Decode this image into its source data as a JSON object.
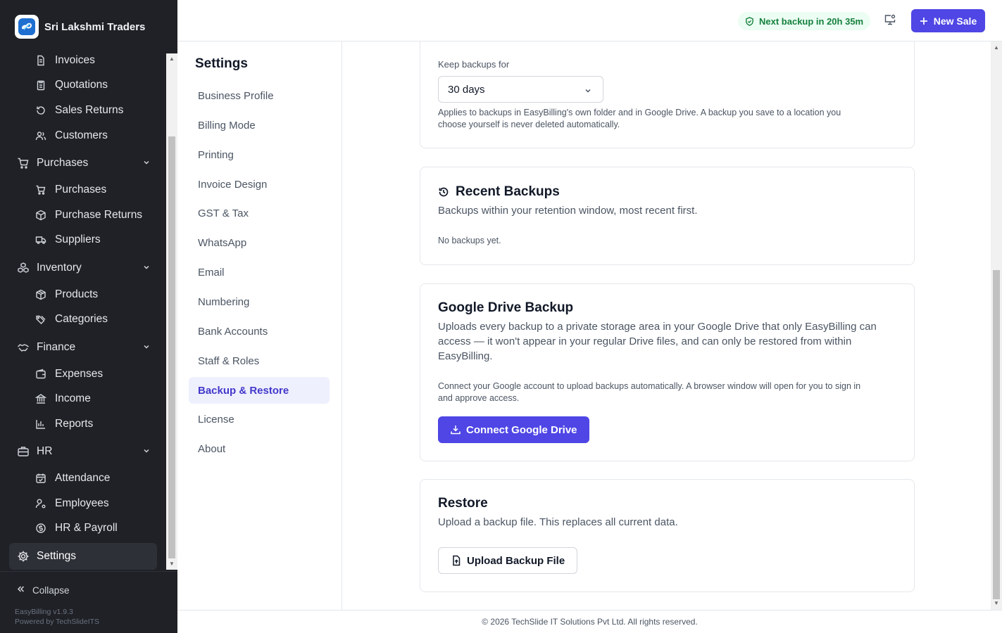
{
  "brand": {
    "name": "Sri Lakshmi Traders",
    "logo_icon": "infinity-logo-icon"
  },
  "sidebar": {
    "items": [
      {
        "label": "Invoices",
        "icon": "file-text-icon",
        "type": "child"
      },
      {
        "label": "Quotations",
        "icon": "clipboard-icon",
        "type": "child"
      },
      {
        "label": "Sales Returns",
        "icon": "rotate-ccw-icon",
        "type": "child"
      },
      {
        "label": "Customers",
        "icon": "users-icon",
        "type": "child"
      },
      {
        "label": "Purchases",
        "icon": "shopping-cart-icon",
        "type": "group"
      },
      {
        "label": "Purchases",
        "icon": "shopping-cart-icon",
        "type": "child"
      },
      {
        "label": "Purchase Returns",
        "icon": "package-return-icon",
        "type": "child"
      },
      {
        "label": "Suppliers",
        "icon": "truck-icon",
        "type": "child"
      },
      {
        "label": "Inventory",
        "icon": "boxes-icon",
        "type": "group"
      },
      {
        "label": "Products",
        "icon": "package-icon",
        "type": "child"
      },
      {
        "label": "Categories",
        "icon": "tags-icon",
        "type": "child"
      },
      {
        "label": "Finance",
        "icon": "handshake-icon",
        "type": "group"
      },
      {
        "label": "Expenses",
        "icon": "wallet-icon",
        "type": "child"
      },
      {
        "label": "Income",
        "icon": "landmark-icon",
        "type": "child"
      },
      {
        "label": "Reports",
        "icon": "bar-chart-icon",
        "type": "child"
      },
      {
        "label": "HR",
        "icon": "briefcase-icon",
        "type": "group"
      },
      {
        "label": "Attendance",
        "icon": "calendar-check-icon",
        "type": "child"
      },
      {
        "label": "Employees",
        "icon": "user-cog-icon",
        "type": "child"
      },
      {
        "label": "HR & Payroll",
        "icon": "badge-dollar-icon",
        "type": "child"
      },
      {
        "label": "Settings",
        "icon": "gear-icon",
        "type": "active"
      }
    ],
    "collapse_label": "Collapse",
    "version_line1": "EasyBilling v1.9.3",
    "version_line2": "Powered by TechSlideITS"
  },
  "topbar": {
    "backup_status": "Next backup in 20h 35m",
    "new_sale_label": "New Sale"
  },
  "settings_nav": {
    "title": "Settings",
    "items": [
      "Business Profile",
      "Billing Mode",
      "Printing",
      "Invoice Design",
      "GST & Tax",
      "WhatsApp",
      "Email",
      "Numbering",
      "Bank Accounts",
      "Staff & Roles",
      "Backup & Restore",
      "License",
      "About"
    ],
    "active": "Backup & Restore"
  },
  "retention": {
    "label": "Keep backups for",
    "selected": "30 days",
    "help_line1": "Applies to backups in EasyBilling's own folder and in Google Drive. A backup you save to a location you",
    "help_line2": "choose yourself is never deleted automatically."
  },
  "recent_backups": {
    "title": "Recent Backups",
    "description": "Backups within your retention window, most recent first.",
    "empty": "No backups yet."
  },
  "google_drive": {
    "title": "Google Drive Backup",
    "desc_line1": "Uploads every backup to a private storage area in your Google Drive that only EasyBilling can",
    "desc_line2": "access — it won't appear in your regular Drive files, and can only be restored from within",
    "desc_line3": "EasyBilling.",
    "note_line1": "Connect your Google account to upload backups automatically. A browser window will open for you to sign in",
    "note_line2": "and approve access.",
    "connect_label": "Connect Google Drive"
  },
  "restore": {
    "title": "Restore",
    "description": "Upload a backup file. This replaces all current data.",
    "upload_label": "Upload Backup File"
  },
  "footer": {
    "text": "© 2026 TechSlide IT Solutions Pvt Ltd. All rights reserved."
  },
  "colors": {
    "primary": "#4f46e5",
    "sidebar_bg": "#1f2126",
    "success": "#15803d"
  }
}
